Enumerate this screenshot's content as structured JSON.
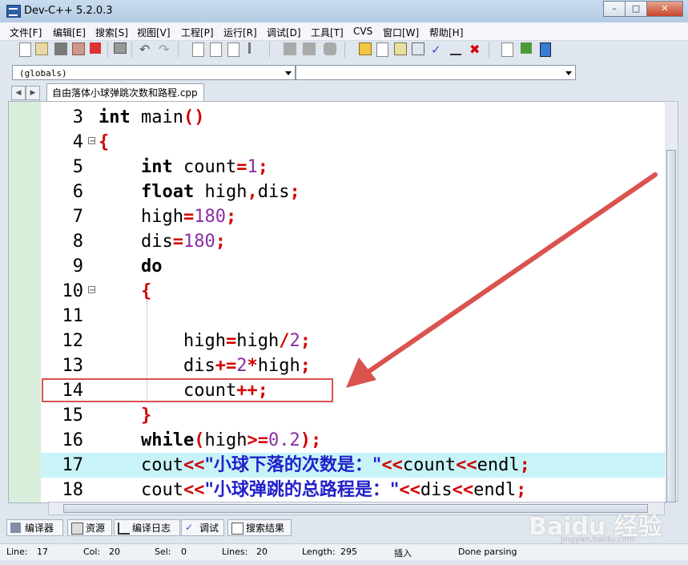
{
  "window": {
    "title": "Dev-C++ 5.2.0.3",
    "buttons": [
      "minimize",
      "maximize",
      "close"
    ]
  },
  "menu": [
    "文件[F]",
    "编辑[E]",
    "搜索[S]",
    "视图[V]",
    "工程[P]",
    "运行[R]",
    "调试[D]",
    "工具[T]",
    "CVS",
    "窗口[W]",
    "帮助[H]"
  ],
  "scope_combo": {
    "selected": "(globals)"
  },
  "member_combo": {
    "selected": ""
  },
  "file_tab": {
    "label": "自由落体小球弹跳次数和路程.cpp"
  },
  "editor": {
    "lines": [
      {
        "num": "3",
        "text": "int main()"
      },
      {
        "num": "4",
        "text": "{"
      },
      {
        "num": "5",
        "text": "    int count=1;"
      },
      {
        "num": "6",
        "text": "    float high,dis;"
      },
      {
        "num": "7",
        "text": "    high=180;"
      },
      {
        "num": "8",
        "text": "    dis=180;"
      },
      {
        "num": "9",
        "text": "    do"
      },
      {
        "num": "10",
        "text": "    {"
      },
      {
        "num": "11",
        "text": ""
      },
      {
        "num": "12",
        "text": "        high=high/2;"
      },
      {
        "num": "13",
        "text": "        dis+=2*high;"
      },
      {
        "num": "14",
        "text": "        count++;"
      },
      {
        "num": "15",
        "text": "    }"
      },
      {
        "num": "16",
        "text": "    while(high>=0.2);"
      },
      {
        "num": "17",
        "text": "    cout<<\"小球下落的次数是：\"<<count<<endl;"
      },
      {
        "num": "18",
        "text": "    cout<<\"小球弹跳的总路程是：\"<<dis<<endl;"
      }
    ],
    "highlighted_line": "17",
    "annotated_line": "14"
  },
  "bottom_tabs": [
    "编译器",
    "资源",
    "编译日志",
    "调试",
    "搜索结果"
  ],
  "status": {
    "line_label": "Line:",
    "line_value": "17",
    "col_label": "Col:",
    "col_value": "20",
    "sel_label": "Sel:",
    "sel_value": "0",
    "lines_label": "Lines:",
    "lines_value": "20",
    "length_label": "Length:",
    "length_value": "295",
    "mode": "插入",
    "message": "Done parsing"
  },
  "watermark": {
    "brand": "Baidu 经验",
    "url": "jingyan.baidu.com"
  },
  "colors": {
    "keyword": "#000000",
    "operator": "#d10000",
    "number": "#8a2ea3",
    "string": "#2020c8",
    "highlight": "#c8f4f8",
    "annotation": "#d9534f"
  }
}
